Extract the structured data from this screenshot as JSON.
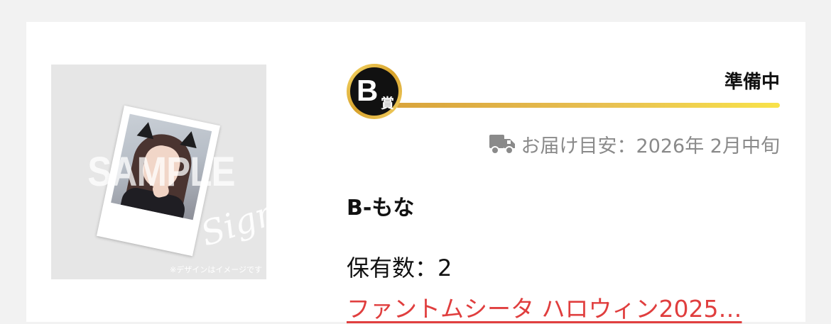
{
  "product": {
    "image": {
      "watermark": "SAMPLE",
      "sign_text": "Sign",
      "caption": "※デザインはイメージです"
    },
    "badge": {
      "letter": "B",
      "suffix": "賞"
    },
    "status": "準備中",
    "delivery": {
      "icon": "truck-icon",
      "text": "お届け目安：2026年 2月中旬"
    },
    "prize_name": "B-もな",
    "holdings": "保有数：2",
    "event_link": "ファントムシータ ハロウィン2025…",
    "colors": {
      "link": "#e03e3e",
      "gold_start": "#d9a43b",
      "gold_end": "#f8e24a",
      "badge_bg": "#111111",
      "muted": "#8a8a8a"
    }
  }
}
